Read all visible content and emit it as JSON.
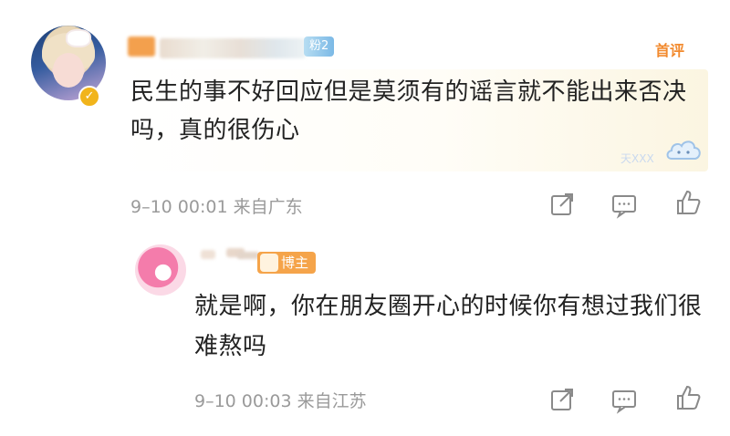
{
  "top_comment": {
    "fan_badge": "粉2",
    "tag": "首评",
    "text": "民生的事不好回应但是莫须有的谣言就不能出来否决吗，真的很伤心",
    "sticker_label": "天XXX",
    "meta": "9–10 00:01 来自广东",
    "colors": {
      "tag": "#f28a2e",
      "fan_badge": "#7bb9e6",
      "verified": "#f1b41b"
    }
  },
  "reply": {
    "badge": "博主",
    "text": "就是啊，你在朋友圈开心的时候你有想过我们很难熬吗",
    "meta": "9–10 00:03 来自江苏",
    "colors": {
      "badge": "#f5a44a"
    }
  },
  "icons": {
    "share": "share-icon",
    "comment": "comment-icon",
    "like": "thumbs-up-icon",
    "verified": "verified-badge-icon"
  }
}
